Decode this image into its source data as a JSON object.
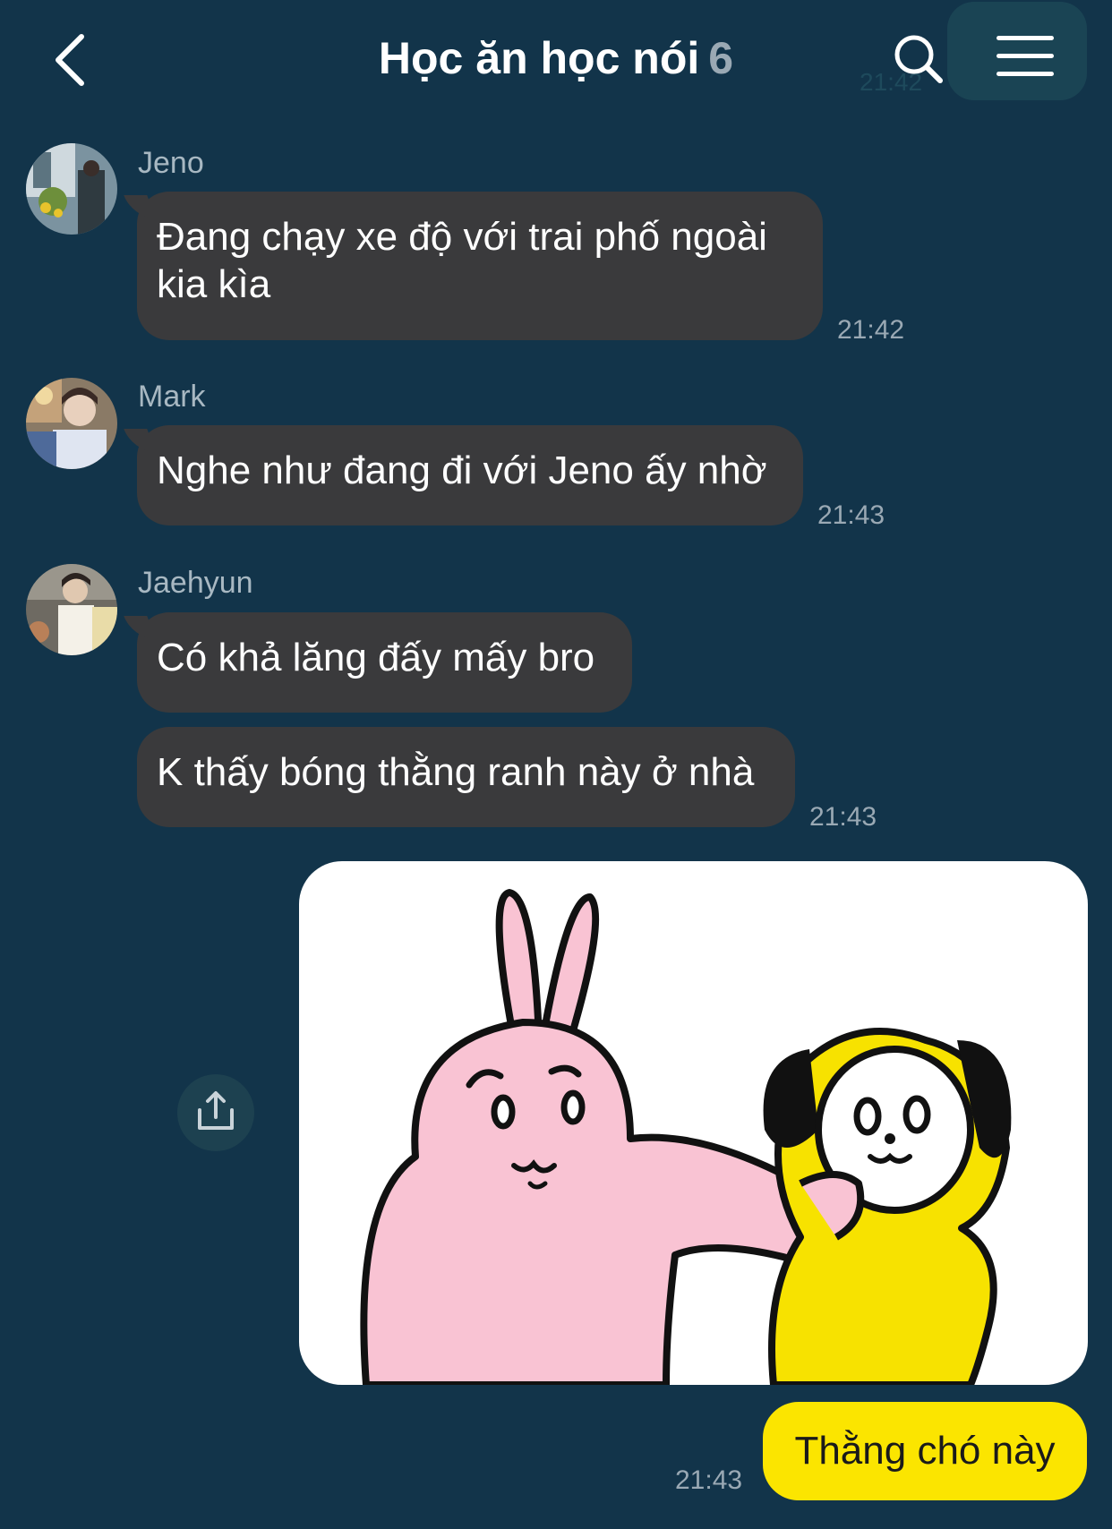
{
  "header": {
    "title": "Học ăn học nói",
    "member_count": "6",
    "ghost_time": "21:42"
  },
  "messages": [
    {
      "sender": "Jeno",
      "text": "Đang chạy xe độ với trai phố ngoài kia kìa",
      "time": "21:42"
    },
    {
      "sender": "Mark",
      "text": "Nghe như đang đi với Jeno ấy nhờ",
      "time": "21:43"
    },
    {
      "sender": "Jaehyun",
      "text_1": "Có khả lăng đấy mấy bro",
      "text_2": "K thấy bóng thằng ranh này ở nhà",
      "time": "21:43"
    }
  ],
  "mine": {
    "text": "Thằng chó này",
    "time": "21:43"
  },
  "icons": {
    "back": "chevron-left-icon",
    "search": "search-icon",
    "menu": "hamburger-menu-icon",
    "share": "share-upload-icon"
  },
  "colors": {
    "background": "#12344a",
    "incoming_bubble": "#3a3a3c",
    "outgoing_bubble": "#fbe500"
  }
}
